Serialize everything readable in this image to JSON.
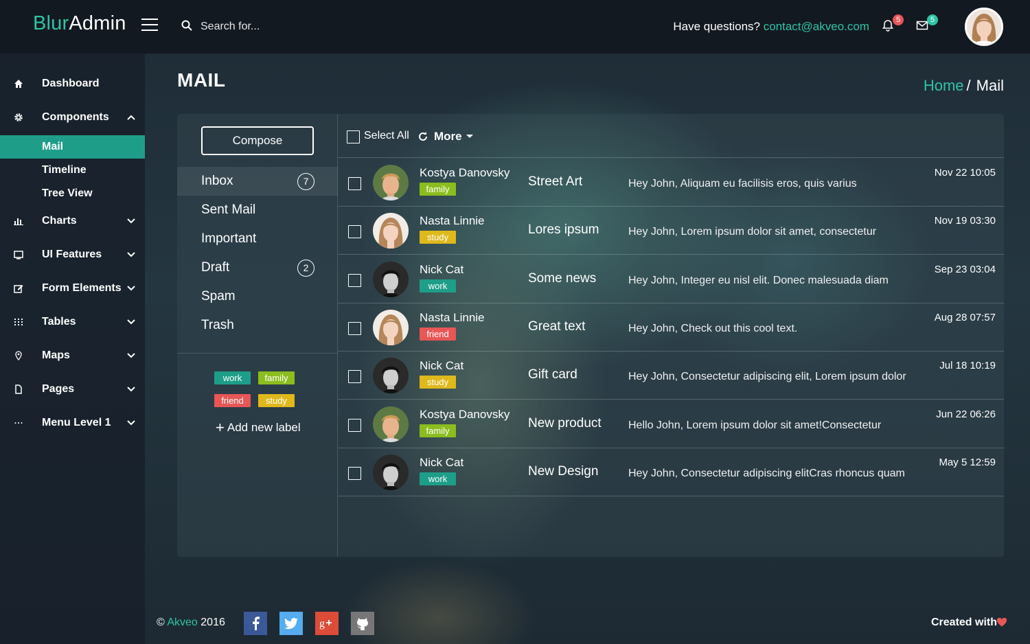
{
  "header": {
    "logo_part1": "Blur",
    "logo_part2": "Admin",
    "search_placeholder": "Search for...",
    "questions_text": "Have questions?",
    "contact_email": "contact@akveo.com",
    "notifications_count": "5",
    "messages_count": "5"
  },
  "sidebar": {
    "items": [
      {
        "label": "Dashboard",
        "icon": "home-icon"
      },
      {
        "label": "Components",
        "icon": "gear-icon",
        "expanded": true
      },
      {
        "label": "Charts",
        "icon": "bar-chart-icon"
      },
      {
        "label": "UI Features",
        "icon": "monitor-icon"
      },
      {
        "label": "Form Elements",
        "icon": "edit-icon"
      },
      {
        "label": "Tables",
        "icon": "grid-icon"
      },
      {
        "label": "Maps",
        "icon": "map-pin-icon"
      },
      {
        "label": "Pages",
        "icon": "file-icon"
      },
      {
        "label": "Menu Level 1",
        "icon": "ellipsis-icon"
      }
    ],
    "sub_items": [
      "Mail",
      "Timeline",
      "Tree View"
    ],
    "active_sub": "Mail"
  },
  "page": {
    "title": "MAIL",
    "breadcrumb_home": "Home",
    "breadcrumb_sep": "/",
    "breadcrumb_current": "Mail"
  },
  "mail_nav": {
    "compose_label": "Compose",
    "folders": [
      {
        "label": "Inbox",
        "count": "7"
      },
      {
        "label": "Sent Mail",
        "count": ""
      },
      {
        "label": "Important",
        "count": ""
      },
      {
        "label": "Draft",
        "count": "2"
      },
      {
        "label": "Spam",
        "count": ""
      },
      {
        "label": "Trash",
        "count": ""
      }
    ],
    "labels": [
      "work",
      "family",
      "friend",
      "study"
    ],
    "add_label": "Add new label"
  },
  "toolbar": {
    "select_all": "Select All",
    "more": "More"
  },
  "messages": [
    {
      "sender": "Kostya Danovsky",
      "tag": "family",
      "subject": "Street Art",
      "preview": "Hey John, Aliquam eu facilisis eros, quis varius",
      "date": "Nov 22 10:05",
      "avatar": "man-blond"
    },
    {
      "sender": "Nasta Linnie",
      "tag": "study",
      "subject": "Lores ipsum",
      "preview": "Hey John, Lorem ipsum dolor sit amet, consectetur",
      "date": "Nov 19 03:30",
      "avatar": "woman"
    },
    {
      "sender": "Nick Cat",
      "tag": "work",
      "subject": "Some news",
      "preview": "Hey John, Integer eu nisl elit. Donec malesuada diam",
      "date": "Sep 23 03:04",
      "avatar": "man-dark"
    },
    {
      "sender": "Nasta Linnie",
      "tag": "friend",
      "subject": "Great text",
      "preview": "Hey John, Check out this cool text.",
      "date": "Aug 28 07:57",
      "avatar": "woman"
    },
    {
      "sender": "Nick Cat",
      "tag": "study",
      "subject": "Gift card",
      "preview": "Hey John, Consectetur adipiscing elit, Lorem ipsum dolor",
      "date": "Jul 18 10:19",
      "avatar": "man-dark"
    },
    {
      "sender": "Kostya Danovsky",
      "tag": "family",
      "subject": "New product",
      "preview": "Hello John, Lorem ipsum dolor sit amet!Consectetur",
      "date": "Jun 22 06:26",
      "avatar": "man-blond"
    },
    {
      "sender": "Nick Cat",
      "tag": "work",
      "subject": "New Design",
      "preview": "Hey John, Consectetur adipiscing elitCras rhoncus quam",
      "date": "May 5 12:59",
      "avatar": "man-dark"
    }
  ],
  "footer": {
    "copyright_symbol": "©",
    "company": "Akveo",
    "year": "2016",
    "created_with": "Created with"
  },
  "colors": {
    "accent": "#2ec4a6",
    "active_menu": "#1e9e88",
    "work": "#1e9e88",
    "family": "#8bbd1e",
    "friend": "#e85656",
    "study": "#dfb81c"
  }
}
